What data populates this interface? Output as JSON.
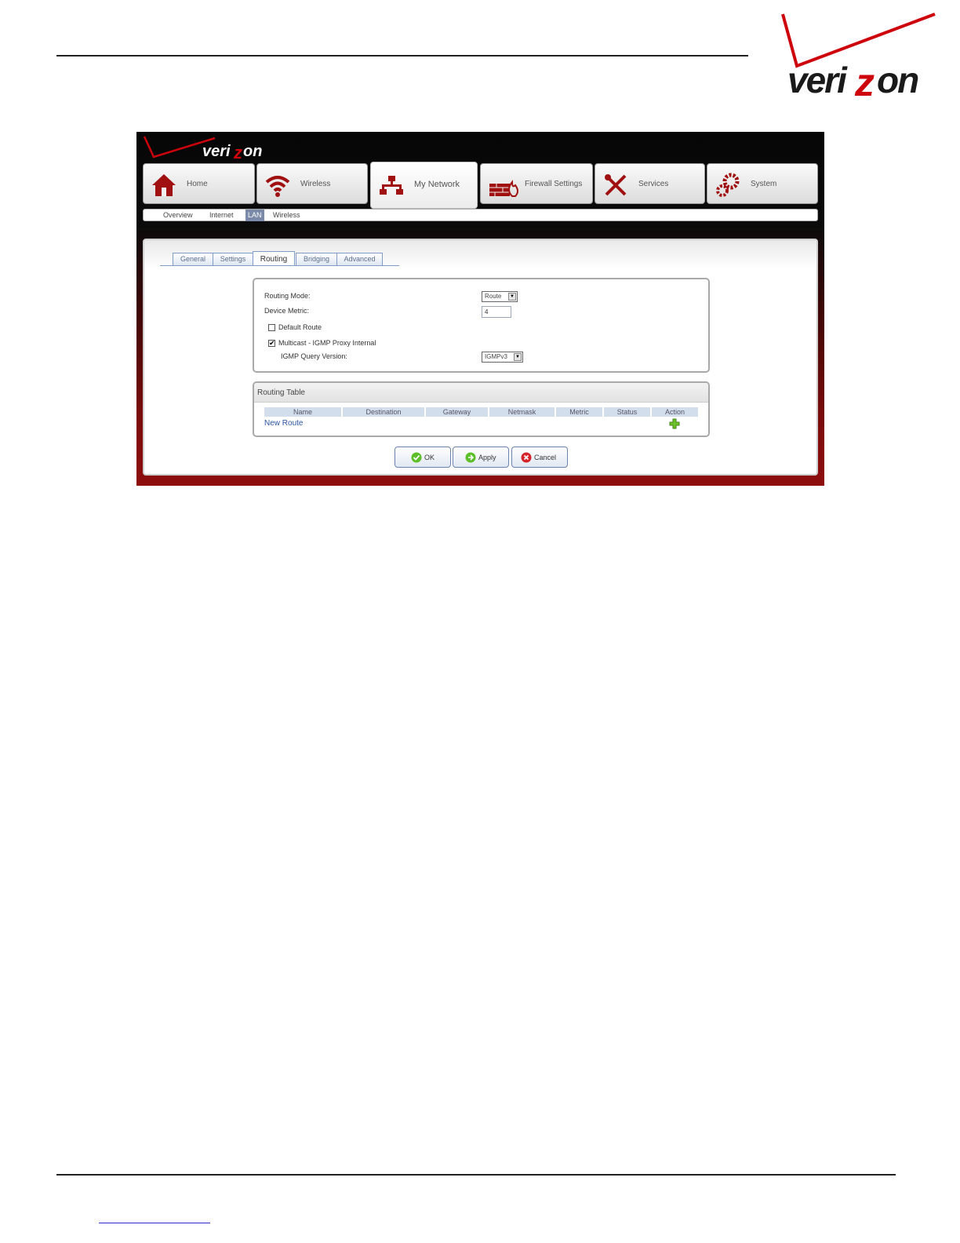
{
  "brand": {
    "name": "verizon",
    "colors": {
      "red": "#cd040b",
      "dark_red": "#8e0d0d",
      "text_dark": "#1a1a1a",
      "link": "#2a55a0"
    }
  },
  "main_nav": [
    {
      "label": "Home",
      "icon": "home-icon",
      "active": false
    },
    {
      "label": "Wireless",
      "icon": "wireless-icon",
      "active": false
    },
    {
      "label": "My Network",
      "icon": "network-icon",
      "active": true
    },
    {
      "label": "Firewall Settings",
      "icon": "firewall-icon",
      "active": false
    },
    {
      "label": "Services",
      "icon": "tools-icon",
      "active": false
    },
    {
      "label": "System",
      "icon": "gears-icon",
      "active": false
    }
  ],
  "sub_nav": [
    {
      "label": "Overview",
      "active": false
    },
    {
      "label": "Internet",
      "active": false
    },
    {
      "label": "LAN",
      "active": true
    },
    {
      "label": "Wireless",
      "active": false
    }
  ],
  "sub_tabs": [
    {
      "label": "General",
      "active": false
    },
    {
      "label": "Settings",
      "active": false
    },
    {
      "label": "Routing",
      "active": true
    },
    {
      "label": "Bridging",
      "active": false
    },
    {
      "label": "Advanced",
      "active": false
    }
  ],
  "settings": {
    "routing_mode_label": "Routing Mode:",
    "routing_mode_value": "Route",
    "device_metric_label": "Device Metric:",
    "device_metric_value": "4",
    "default_route_label": "Default Route",
    "default_route_checked": false,
    "multicast_label": "Multicast - IGMP Proxy Internal",
    "multicast_checked": true,
    "igmp_query_label": "IGMP Query Version:",
    "igmp_query_value": "IGMPv3"
  },
  "routing_table": {
    "title": "Routing Table",
    "columns": [
      "Name",
      "Destination",
      "Gateway",
      "Netmask",
      "Metric",
      "Status",
      "Action"
    ],
    "new_route_label": "New Route",
    "add_icon": "plus-icon"
  },
  "buttons": {
    "ok": "OK",
    "apply": "Apply",
    "cancel": "Cancel"
  }
}
